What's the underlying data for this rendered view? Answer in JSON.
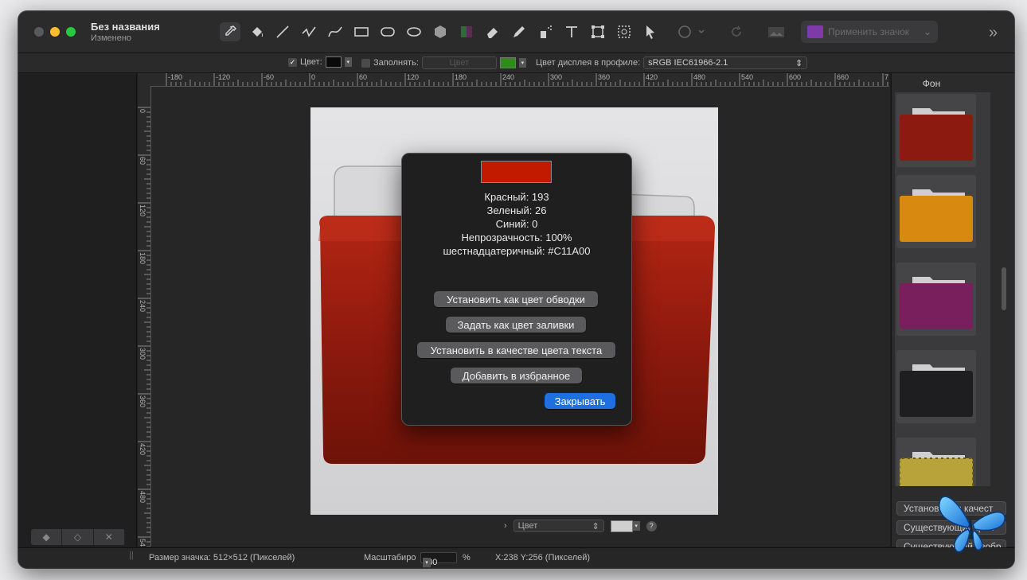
{
  "window": {
    "title": "Без названия",
    "subtitle": "Изменено"
  },
  "toolbar": {
    "tools": [
      "eyedropper-icon",
      "paint-bucket-icon",
      "line-icon",
      "polyline-icon",
      "curve-icon",
      "rectangle-icon",
      "rounded-rect-icon",
      "ellipse-icon",
      "hexagon-icon",
      "gradient-icon",
      "eraser-icon",
      "pencil-icon",
      "spray-icon",
      "text-icon",
      "transform-icon",
      "crop-select-icon",
      "pointer-icon",
      "more-shapes-icon",
      "rotate-icon",
      "image-icon"
    ],
    "apply_label": "Применить значок",
    "overflow_icon": "double-chevron-right-icon"
  },
  "options": {
    "color_label": "Цвет:",
    "fill_label": "Заполнять:",
    "fill_select": "Цвет",
    "display_label": "Цвет дисплея в профиле:",
    "profile_value": "sRGB IEC61966-2.1",
    "stroke_color": "#0a0a0a",
    "fill_color": "#2e8b1c"
  },
  "rulers": {
    "h_labels": [
      "-180",
      "-120",
      "-60",
      "0",
      "60",
      "120",
      "180",
      "240",
      "300",
      "360",
      "420",
      "480",
      "540",
      "600",
      "660",
      "7"
    ],
    "v_labels": [
      "0",
      "60",
      "120",
      "180",
      "240",
      "300",
      "360",
      "420",
      "480",
      "54"
    ]
  },
  "canvas_bar": {
    "select_value": "Цвет",
    "help": "?"
  },
  "right_panel": {
    "heading": "Фон",
    "thumbs": [
      {
        "name": "red-folder",
        "color": "#8c1a10"
      },
      {
        "name": "orange-folder",
        "color": "#d88a10"
      },
      {
        "name": "purple-folder",
        "color": "#7a1f5e"
      },
      {
        "name": "black-folder",
        "color": "#1e1e20"
      },
      {
        "name": "pattern-folder",
        "color": "#b8a23a"
      }
    ],
    "buttons": [
      "Установить в качест",
      "Существующий фон",
      "Существующий изобр"
    ]
  },
  "status": {
    "size": "Размер значка: 512×512 (Пикселей)",
    "zoom_label": "Масштабиро",
    "zoom_value": "100",
    "zoom_unit": "%",
    "coords": "X:238 Y:256 (Пикселей)"
  },
  "dialog": {
    "swatch_color": "#c11a00",
    "red": "Красный: 193",
    "green": "Зеленый: 26",
    "blue": "Синий: 0",
    "opacity": "Непрозрачность: 100%",
    "hex": "шестнадцатеричный: #C11A00",
    "btn_stroke": "Установить как цвет обводки",
    "btn_fill": "Задать как цвет заливки",
    "btn_text": "Установить в качестве цвета текста",
    "btn_fav": "Добавить в избранное",
    "btn_close": "Закрывать"
  }
}
